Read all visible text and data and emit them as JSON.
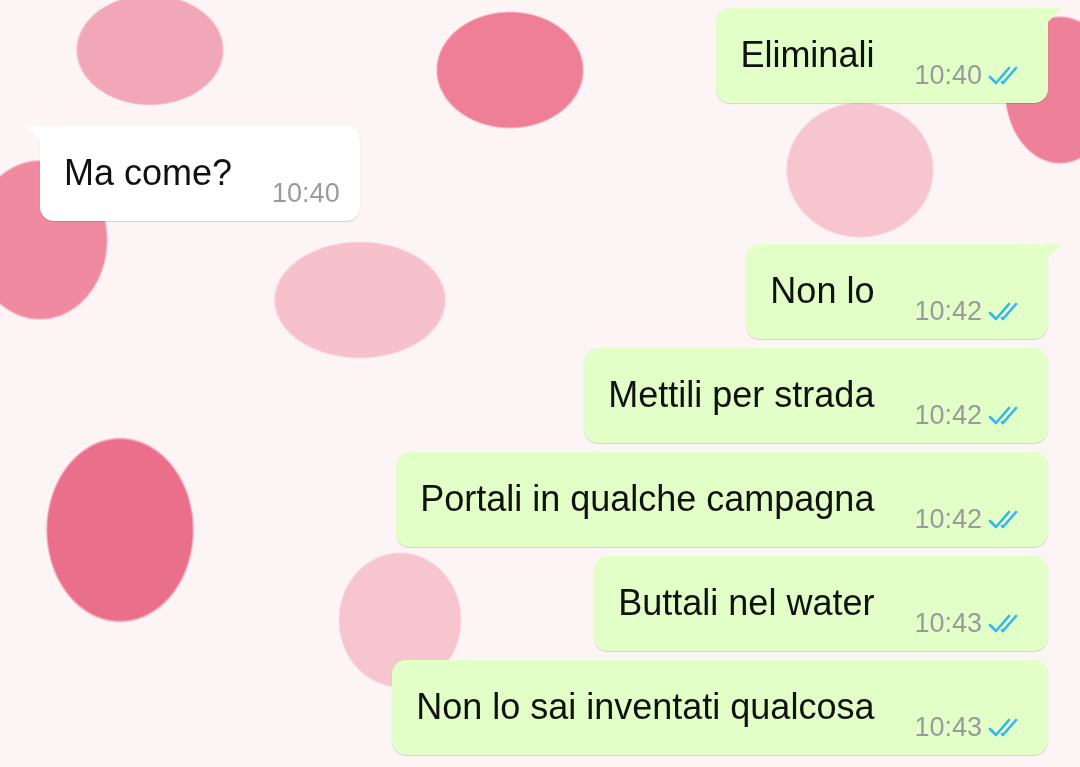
{
  "messages": [
    {
      "kind": "sent",
      "text": "Eliminali",
      "time": "10:40",
      "read": true,
      "tail": true
    },
    {
      "kind": "received",
      "text": "Ma come?",
      "time": "10:40",
      "tail": true
    },
    {
      "kind": "sent",
      "text": "Non lo",
      "time": "10:42",
      "read": true,
      "tail": true
    },
    {
      "kind": "sent",
      "text": "Mettili per strada",
      "time": "10:42",
      "read": true,
      "tail": false
    },
    {
      "kind": "sent",
      "text": "Portali in qualche campagna",
      "time": "10:42",
      "read": true,
      "tail": false
    },
    {
      "kind": "sent",
      "text": "Buttali nel water",
      "time": "10:43",
      "read": true,
      "tail": false
    },
    {
      "kind": "sent",
      "text": "Non lo sai inventati qualcosa",
      "time": "10:43",
      "read": true,
      "tail": false
    }
  ]
}
